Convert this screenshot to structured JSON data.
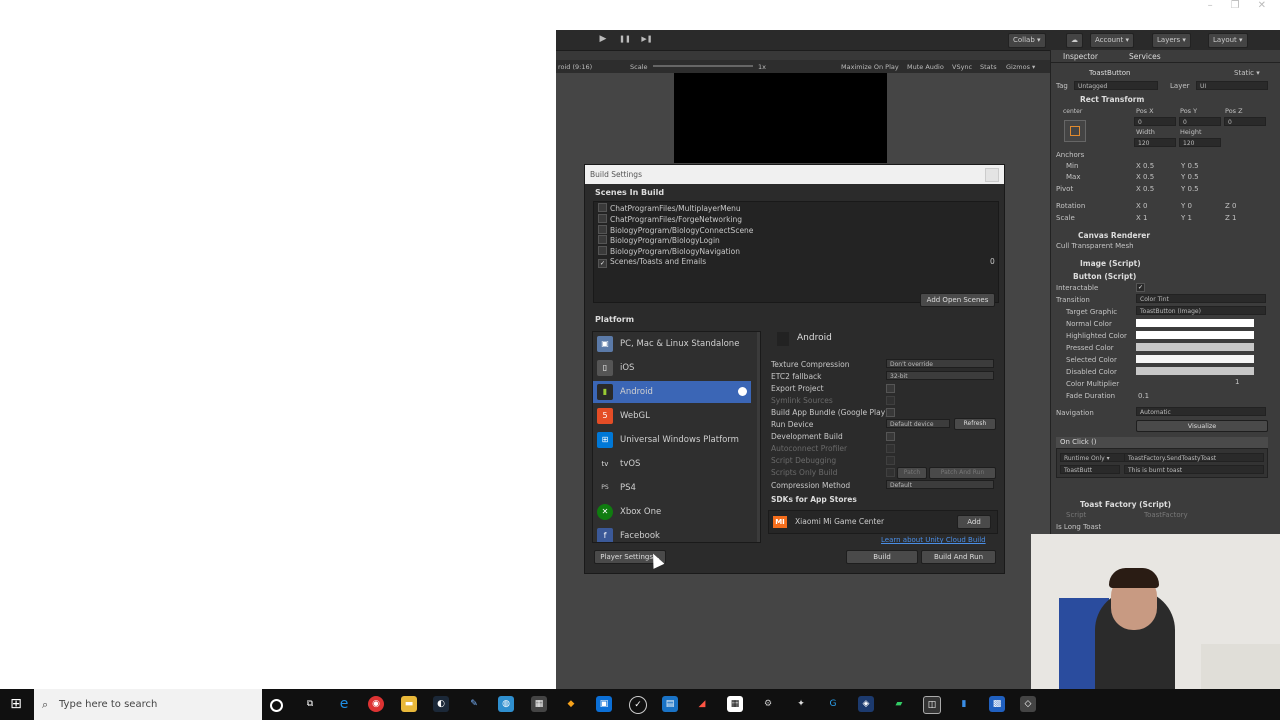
{
  "window": {
    "controls": [
      "–",
      "❐",
      "✕"
    ]
  },
  "toolbar": {
    "play": "▶",
    "pause": "❚❚",
    "step": "▶❚",
    "collab": "Collab ▾",
    "cloud": "☁",
    "account": "Account ▾",
    "layers": "Layers ▾",
    "layout": "Layout ▾"
  },
  "gamebar": {
    "aspect": "roid (9:16)",
    "scale_label": "Scale",
    "scale_value": "1x",
    "maximize": "Maximize On Play",
    "mute": "Mute Audio",
    "vsync": "VSync",
    "stats": "Stats",
    "gizmos": "Gizmos ▾"
  },
  "inspector": {
    "tab_inspector": "Inspector",
    "tab_services": "Services",
    "object_name": "ToastButton",
    "static": "Static ▾",
    "tag_label": "Tag",
    "tag_value": "Untagged",
    "layer_label": "Layer",
    "layer_value": "UI",
    "rect_transform": "Rect Transform",
    "center": "center",
    "middle": "middle",
    "posx": "Pos X",
    "posy": "Pos Y",
    "posz": "Pos Z",
    "posx_v": "0",
    "posy_v": "0",
    "posz_v": "0",
    "width": "Width",
    "height": "Height",
    "width_v": "120",
    "height_v": "120",
    "anchors": "Anchors",
    "min": "Min",
    "max": "Max",
    "pivot": "Pivot",
    "min_x": "X 0.5",
    "min_y": "Y 0.5",
    "max_x": "X 0.5",
    "max_y": "Y 0.5",
    "pivot_x": "X 0.5",
    "pivot_y": "Y 0.5",
    "rotation": "Rotation",
    "scale": "Scale",
    "rot_x": "X 0",
    "rot_y": "Y 0",
    "rot_z": "Z 0",
    "scl_x": "X 1",
    "scl_y": "Y 1",
    "scl_z": "Z 1",
    "canvas_renderer": "Canvas Renderer",
    "cull": "Cull Transparent Mesh",
    "image_script": "Image (Script)",
    "button_script": "Button (Script)",
    "interactable": "Interactable",
    "transition": "Transition",
    "transition_v": "Color Tint",
    "target_graphic": "Target Graphic",
    "target_graphic_v": "ToastButton (Image)",
    "normal": "Normal Color",
    "highlighted": "Highlighted Color",
    "pressed": "Pressed Color",
    "selected": "Selected Color",
    "disabled": "Disabled Color",
    "multiplier": "Color Multiplier",
    "multiplier_v": "1",
    "fade": "Fade Duration",
    "fade_v": "0.1",
    "navigation": "Navigation",
    "navigation_v": "Automatic",
    "visualize": "Visualize",
    "onclick": "On Click ()",
    "runtime": "Runtime Only ▾",
    "func": "ToastFactory.SendToastyToast",
    "obj": "ToastButt",
    "arg": "This is burnt toast",
    "toast_factory": "Toast Factory (Script)",
    "script_label": "Script",
    "script_v": "ToastFactory",
    "is_long": "Is Long Toast"
  },
  "dialog": {
    "title": "Build Settings",
    "scenes_header": "Scenes In Build",
    "scenes": [
      {
        "name": "ChatProgramFiles/MultiplayerMenu",
        "checked": false
      },
      {
        "name": "ChatProgramFiles/ForgeNetworking",
        "checked": false
      },
      {
        "name": "BiologyProgram/BiologyConnectScene",
        "checked": false
      },
      {
        "name": "BiologyProgram/BiologyLogin",
        "checked": false
      },
      {
        "name": "BiologyProgram/BiologyNavigation",
        "checked": false
      },
      {
        "name": "Scenes/Toasts and Emails",
        "checked": true
      }
    ],
    "scene_index": "0",
    "add_open_scenes": "Add Open Scenes",
    "platform_header": "Platform",
    "platforms": [
      {
        "label": "PC, Mac & Linux Standalone",
        "icon": "pc-icon"
      },
      {
        "label": "iOS",
        "icon": "ios-icon"
      },
      {
        "label": "Android",
        "icon": "android-icon"
      },
      {
        "label": "WebGL",
        "icon": "webgl-icon"
      },
      {
        "label": "Universal Windows Platform",
        "icon": "windows-icon"
      },
      {
        "label": "tvOS",
        "icon": "tvos-icon"
      },
      {
        "label": "PS4",
        "icon": "ps4-icon"
      },
      {
        "label": "Xbox One",
        "icon": "xbox-icon"
      },
      {
        "label": "Facebook",
        "icon": "facebook-icon"
      }
    ],
    "selected_platform": "Android",
    "options": {
      "texture_compression": "Texture Compression",
      "texture_compression_v": "Don't override",
      "etc2": "ETC2 fallback",
      "etc2_v": "32-bit",
      "export": "Export Project",
      "symlink": "Symlink Sources",
      "bundle": "Build App Bundle (Google Play)",
      "run_device": "Run Device",
      "run_device_v": "Default device",
      "refresh": "Refresh",
      "dev_build": "Development Build",
      "autoconnect": "Autoconnect Profiler",
      "script_debug": "Script Debugging",
      "scripts_only": "Scripts Only Build",
      "patch": "Patch",
      "patch_run": "Patch And Run",
      "compression": "Compression Method",
      "compression_v": "Default"
    },
    "sdks_header": "SDKs for App Stores",
    "sdk_name": "Xiaomi Mi Game Center",
    "sdk_add": "Add",
    "cloud_link": "Learn about Unity Cloud Build",
    "player_settings": "Player Settings...",
    "build": "Build",
    "build_and_run": "Build And Run"
  },
  "taskbar": {
    "search_placeholder": "Type here to search"
  }
}
